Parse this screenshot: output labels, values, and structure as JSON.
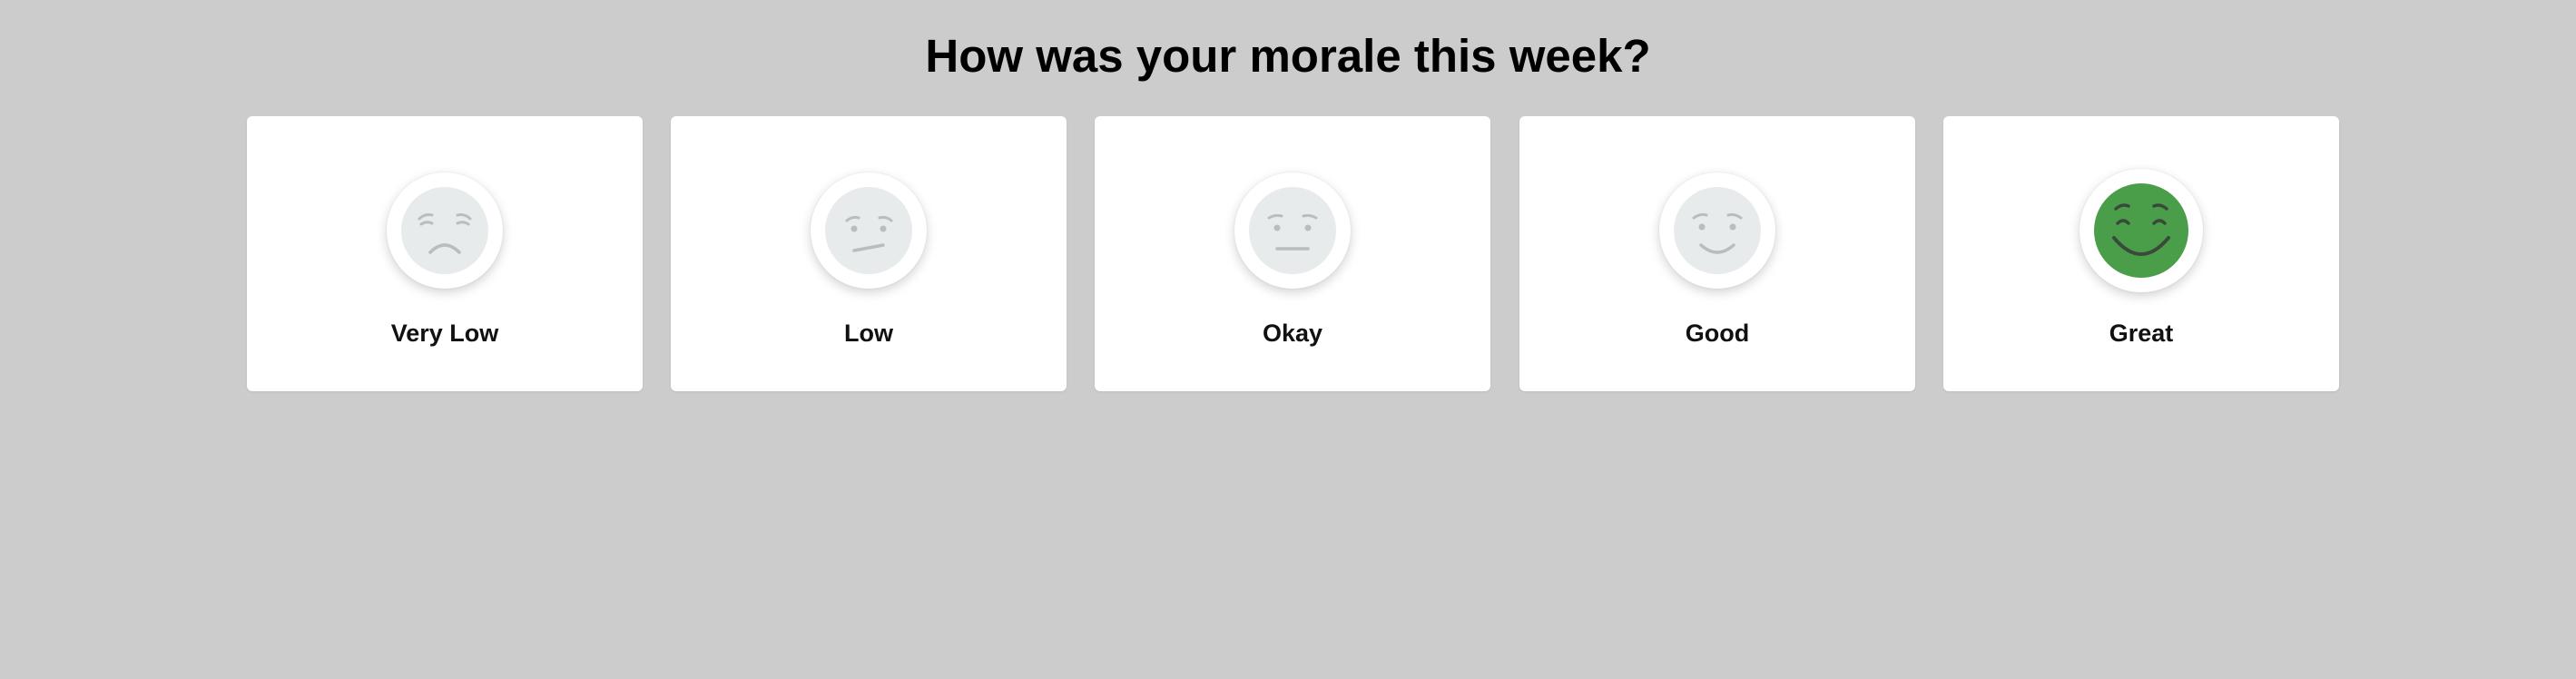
{
  "survey": {
    "question": "How was your morale this week?"
  },
  "options": [
    {
      "label": "Very Low",
      "icon": "very-low-face-icon",
      "selected": false
    },
    {
      "label": "Low",
      "icon": "low-face-icon",
      "selected": false
    },
    {
      "label": "Okay",
      "icon": "okay-face-icon",
      "selected": false
    },
    {
      "label": "Good",
      "icon": "good-face-icon",
      "selected": false
    },
    {
      "label": "Great",
      "icon": "great-face-icon",
      "selected": true
    }
  ],
  "colors": {
    "background": "#cccccc",
    "card": "#ffffff",
    "face_inactive": "#e8ebec",
    "feature_inactive": "#b8bdc0",
    "face_selected": "#4a9e4a",
    "feature_selected": "#3a4a3a"
  }
}
